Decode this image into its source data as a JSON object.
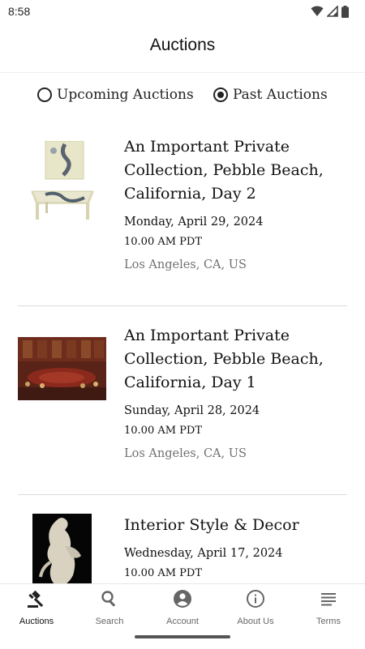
{
  "status_bar": {
    "time": "8:58"
  },
  "header": {
    "title": "Auctions"
  },
  "filter": {
    "options": [
      {
        "label": "Upcoming Auctions",
        "selected": false
      },
      {
        "label": "Past Auctions",
        "selected": true
      }
    ]
  },
  "auctions": [
    {
      "title_lines": [
        "An Important Private",
        "Collection, Pebble Beach,",
        "California, Day 2"
      ],
      "date": "Monday, April 29, 2024",
      "time": "10.00 AM PDT",
      "location": "Los Angeles, CA, US"
    },
    {
      "title_lines": [
        "An Important Private",
        "Collection, Pebble Beach,",
        "California, Day 1"
      ],
      "date": "Sunday, April 28, 2024",
      "time": "10.00 AM PDT",
      "location": "Los Angeles, CA, US"
    },
    {
      "title_lines": [
        "Interior Style & Decor"
      ],
      "date": "Wednesday, April 17, 2024",
      "time": "10.00 AM PDT",
      "location": ""
    }
  ],
  "nav": {
    "items": [
      {
        "label": "Auctions",
        "icon": "gavel-icon",
        "active": true
      },
      {
        "label": "Search",
        "icon": "search-icon",
        "active": false
      },
      {
        "label": "Account",
        "icon": "account-icon",
        "active": false
      },
      {
        "label": "About Us",
        "icon": "info-icon",
        "active": false
      },
      {
        "label": "Terms",
        "icon": "menu-icon",
        "active": false
      }
    ]
  }
}
